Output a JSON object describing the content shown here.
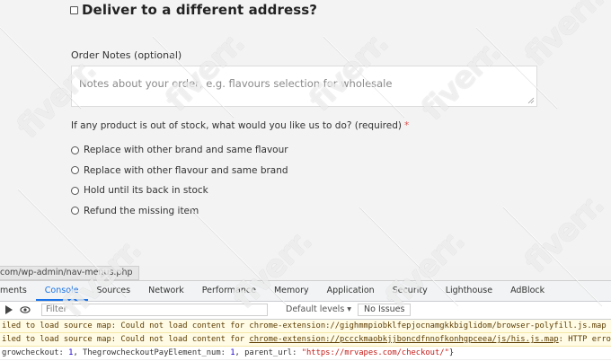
{
  "checkout": {
    "deliver_label": "Deliver to a different address?",
    "order_notes_label": "Order Notes (optional)",
    "order_notes_placeholder": "Notes about your order, e.g. flavours selection for wholesale",
    "oos_question": "If any product is out of stock, what would you like us to do? (required)",
    "required_mark": "*",
    "options": [
      "Replace with other brand and same flavour",
      "Replace with other flavour and same brand",
      "Hold until its back in stock",
      "Refund the missing item"
    ]
  },
  "devtools": {
    "url_fragment": "com/wp-admin/nav-menus.php",
    "tabs": [
      "ments",
      "Console",
      "Sources",
      "Network",
      "Performance",
      "Memory",
      "Application",
      "Security",
      "Lighthouse",
      "AdBlock"
    ],
    "active_tab": "Console",
    "filter_placeholder": "Filter",
    "levels_label": "Default levels ▾",
    "issues_label": "No Issues",
    "logs": {
      "row1": "iled to load source map: Could not load content for chrome-extension://gighmmpiobklfepjocnamgkkbiglidom/browser-polyfill.js.map",
      "row2_pre": "iled to load source map: Could not load content for ",
      "row2_link": "chrome-extension://pccckmaobkjjboncdfnnofkonhgpceea/js/his.js.map",
      "row2_post": ": HTTP error",
      "row3_a": "growcheckout: ",
      "row3_b": "1",
      "row3_c": ", ThegrowcheckoutPayElement_num: ",
      "row3_d": "1",
      "row3_e": ", parent_url: ",
      "row3_f": "\"https://mrvapes.com/checkout/\"",
      "row3_g": "}"
    }
  },
  "watermark": "fiverr."
}
